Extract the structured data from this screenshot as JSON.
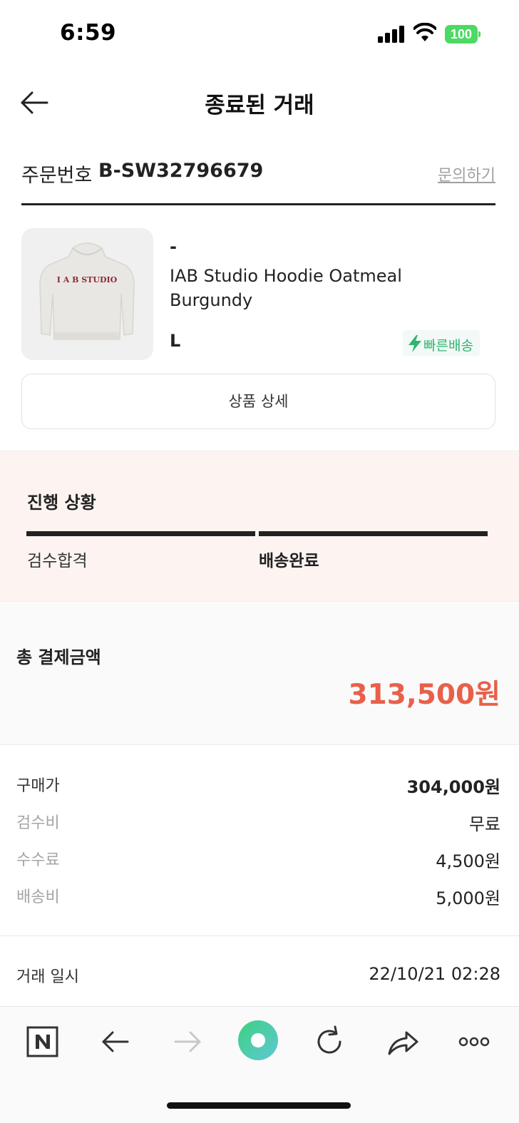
{
  "status_bar": {
    "time": "6:59",
    "battery": "100"
  },
  "header": {
    "title": "종료된 거래"
  },
  "order": {
    "label": "주문번호",
    "number": "B-SW32796679",
    "inquiry": "문의하기"
  },
  "product": {
    "brand": "-",
    "name": "IAB Studio Hoodie Oatmeal Burgundy",
    "size": "L",
    "badge": "빠른배송",
    "detail_button": "상품 상세",
    "image_print": "I A B STUDIO"
  },
  "progress": {
    "title": "진행 상황",
    "steps": [
      {
        "label": "검수합격"
      },
      {
        "label": "배송완료"
      }
    ]
  },
  "total": {
    "label": "총 결제금액",
    "amount": "313,500원"
  },
  "breakdown": [
    {
      "label": "구매가",
      "value": "304,000원"
    },
    {
      "label": "검수비",
      "value": "무료"
    },
    {
      "label": "수수료",
      "value": "4,500원"
    },
    {
      "label": "배송비",
      "value": "5,000원"
    }
  ],
  "trade_date": {
    "label": "거래 일시",
    "value": "22/10/21 02:28"
  },
  "toolbar": {
    "items": [
      "naver-icon",
      "back-icon",
      "forward-icon",
      "home-icon",
      "reload-icon",
      "share-icon",
      "more-icon"
    ]
  },
  "colors": {
    "accent_red": "#e8604a",
    "fast_green": "#31b46e",
    "progress_bg": "#fdf4f1"
  }
}
